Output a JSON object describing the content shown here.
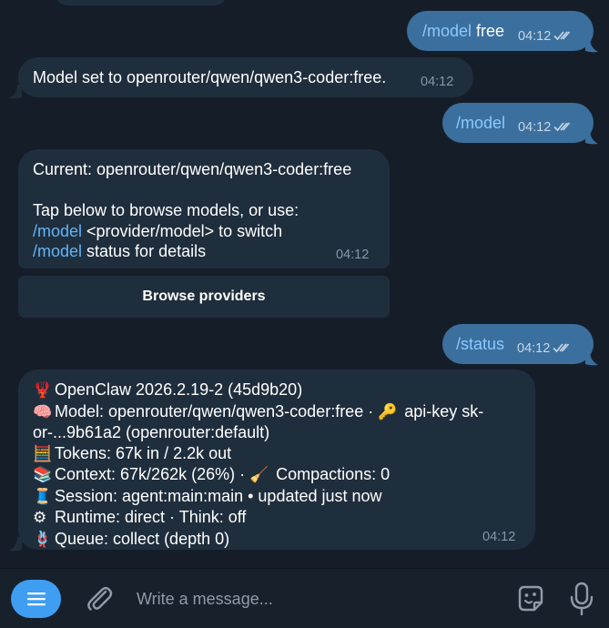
{
  "messages": {
    "out1": {
      "command": "/model",
      "text": " free",
      "time": "04:12"
    },
    "in1": {
      "text": "Model set to openrouter/qwen/qwen3-coder:free.",
      "time": "04:12"
    },
    "out2": {
      "command": "/model",
      "time": "04:12"
    },
    "in2": {
      "line1": "Current: openrouter/qwen/qwen3-coder:free",
      "line2": "Tap below to browse models, or use:",
      "line3_cmd": "/model",
      "line3_text": " <provider/model> to switch",
      "line4_cmd": "/model",
      "line4_text": " status for details",
      "time": "04:12"
    },
    "browse_button": "Browse providers",
    "out3": {
      "command": "/status",
      "time": "04:12"
    },
    "in3": {
      "emoji": [
        "🦞",
        "🧠",
        "🔑",
        "🧮",
        "📚",
        "🧹",
        "🧵",
        "⚙",
        "🪢"
      ],
      "line1": "OpenClaw 2026.2.19-2 (45d9b20)",
      "line2a": "Model: openrouter/qwen/qwen3-coder:free · ",
      "line2b": " api-key sk-",
      "line3": "or-...9b61a2 (openrouter:default)",
      "line4": "Tokens: 67k in / 2.2k out",
      "line5a": "Context: 67k/262k (26%) · ",
      "line5b": "  Compactions: 0",
      "line6": "Session: agent:main:main • updated just now",
      "line7": "Runtime: direct · Think: off",
      "line8": "Queue: collect (depth 0)",
      "time": "04:12"
    }
  },
  "composer": {
    "placeholder": "Write a message..."
  },
  "colors": {
    "background": "#151e28",
    "incoming": "#1f2e3d",
    "outgoing": "#3b6f9e",
    "accent": "#3f9ef2",
    "command": "#62b4f7"
  }
}
